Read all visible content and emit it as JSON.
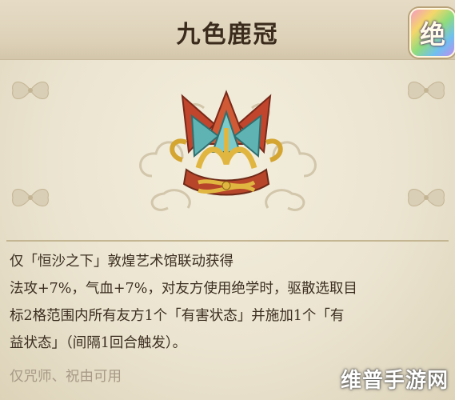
{
  "item": {
    "name": "九色鹿冠",
    "rarity_badge": "绝",
    "icon": "nine-color-deer-crown-icon"
  },
  "description": {
    "lines": [
      "仅「恒沙之下」敦煌艺术馆联动获得",
      "法攻+7%，气血+7%，对友方使用绝学时，驱散选取目",
      "标2格范围内所有友方1个「有害状态」并施加1个「有",
      "益状态」（间隔1回合触发）。"
    ],
    "usage": "仅咒师、祝由可用"
  },
  "watermark": "维普手游网",
  "colors": {
    "title": "#3a2b1c",
    "body_text": "#3b2e20",
    "usage_text": "#a79a86",
    "background": "#ebe4d0"
  }
}
